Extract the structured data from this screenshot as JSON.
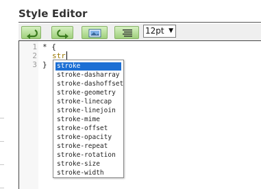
{
  "panel": {
    "title": "Style Editor"
  },
  "toolbar": {
    "buttons": [
      {
        "icon": "undo-arrow-icon"
      },
      {
        "icon": "redo-arrow-icon"
      },
      {
        "icon": "image-icon"
      },
      {
        "icon": "lines-format-icon"
      }
    ],
    "font_size": {
      "value": "12pt",
      "arrow": "▼"
    }
  },
  "editor": {
    "line_numbers": [
      "1",
      "2",
      "3"
    ],
    "lines": [
      {
        "text": "* {"
      },
      {
        "text": "str"
      },
      {
        "text": "}"
      }
    ]
  },
  "autocomplete": {
    "selected_index": 0,
    "items": [
      "stroke",
      "stroke-dasharray",
      "stroke-dashoffset",
      "stroke-geometry",
      "stroke-linecap",
      "stroke-linejoin",
      "stroke-mime",
      "stroke-offset",
      "stroke-opacity",
      "stroke-repeat",
      "stroke-rotation",
      "stroke-size",
      "stroke-width"
    ]
  },
  "colors": {
    "selection": "#1c6fd4",
    "button_green": "#9fd07c",
    "typed_text": "#9a7700"
  }
}
